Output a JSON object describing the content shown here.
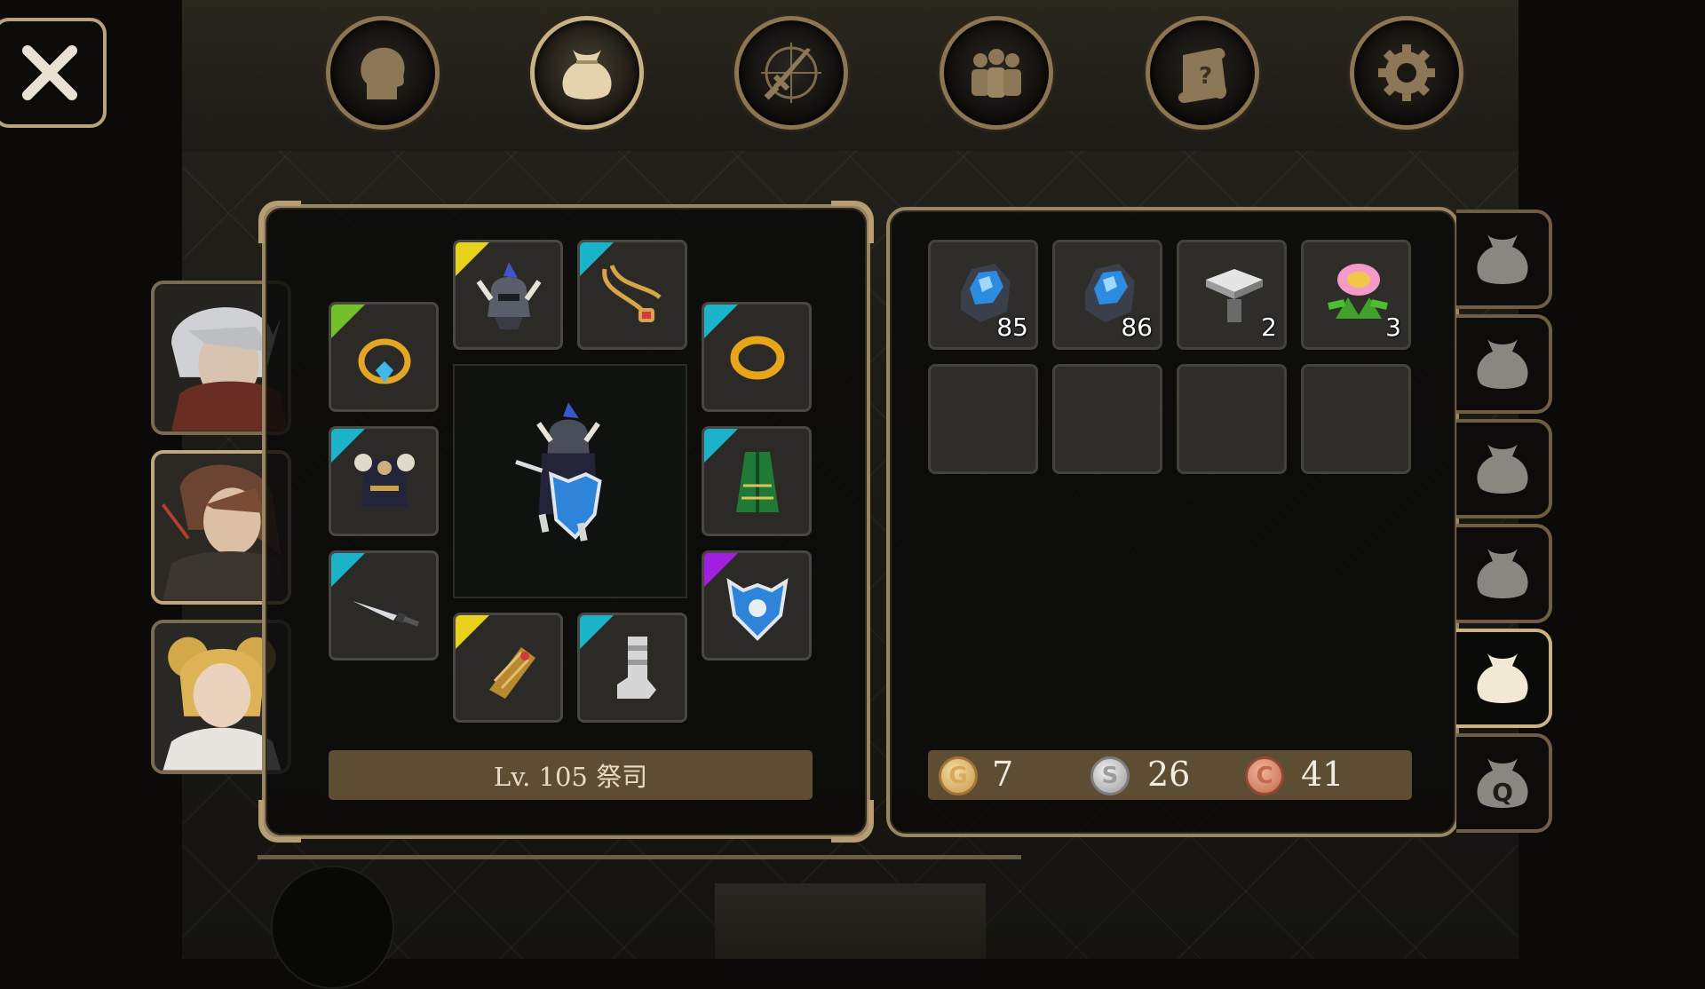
{
  "top_nav": [
    {
      "id": "character",
      "icon": "head-icon"
    },
    {
      "id": "inventory",
      "icon": "bag-icon",
      "active": true
    },
    {
      "id": "skills",
      "icon": "sword-compass-icon"
    },
    {
      "id": "party",
      "icon": "party-icon"
    },
    {
      "id": "quests",
      "icon": "scroll-icon"
    },
    {
      "id": "settings",
      "icon": "gear-icon"
    }
  ],
  "portraits": [
    {
      "id": "silver-haired-warrior",
      "active": false
    },
    {
      "id": "brown-haired-archer",
      "active": true
    },
    {
      "id": "blonde-priestess",
      "active": false
    }
  ],
  "equipment": {
    "slots": [
      {
        "slot": "helmet",
        "icon": "helmet-icon",
        "rarity": "yellow"
      },
      {
        "slot": "necklace",
        "icon": "necklace-icon",
        "rarity": "cyan"
      },
      {
        "slot": "ring-left",
        "icon": "ring-gem-icon",
        "rarity": "green"
      },
      {
        "slot": "ring-right",
        "icon": "ring-gold-icon",
        "rarity": "cyan"
      },
      {
        "slot": "armor",
        "icon": "armor-icon",
        "rarity": "cyan"
      },
      {
        "slot": "cloak",
        "icon": "cloak-icon",
        "rarity": "cyan"
      },
      {
        "slot": "weapon",
        "icon": "dagger-icon",
        "rarity": "cyan"
      },
      {
        "slot": "shield",
        "icon": "shield-icon",
        "rarity": "purple"
      },
      {
        "slot": "gloves",
        "icon": "gloves-icon",
        "rarity": "yellow"
      },
      {
        "slot": "boots",
        "icon": "boots-icon",
        "rarity": "cyan"
      }
    ],
    "level_label": "Lv. 105 祭司"
  },
  "inventory": {
    "items": [
      {
        "icon": "blue-ore-icon",
        "count": "85"
      },
      {
        "icon": "blue-ore-icon",
        "count": "86"
      },
      {
        "icon": "anvil-icon",
        "count": "2"
      },
      {
        "icon": "pink-flower-icon",
        "count": "3"
      }
    ],
    "empty_slots": 4
  },
  "currency": {
    "gold": {
      "symbol": "G",
      "amount": "7"
    },
    "silver": {
      "symbol": "S",
      "amount": "26"
    },
    "copper": {
      "symbol": "C",
      "amount": "41"
    }
  },
  "bag_tabs": [
    {
      "icon": "bag-icon",
      "active": false
    },
    {
      "icon": "bag-icon",
      "active": false
    },
    {
      "icon": "bag-icon",
      "active": false
    },
    {
      "icon": "bag-icon",
      "active": false
    },
    {
      "icon": "bag-icon",
      "active": true
    },
    {
      "icon": "quest-bag-icon",
      "label": "Q",
      "active": false
    }
  ]
}
